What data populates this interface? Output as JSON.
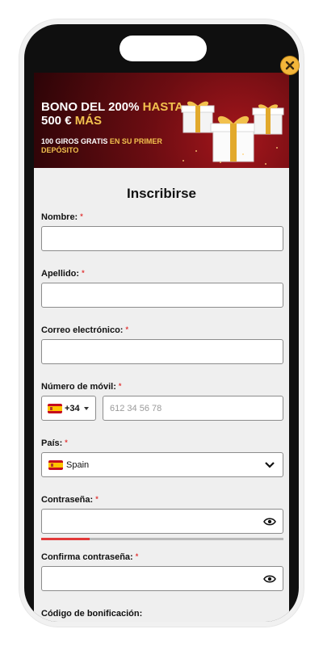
{
  "banner": {
    "title_white_1": "BONO DEL 200%",
    "title_gold_1": "HASTA",
    "title_white_2": "500 €",
    "title_gold_2": "MÁS",
    "sub_white": "100 GIROS GRATIS",
    "sub_gold": "EN SU PRIMER DEPÓSITO"
  },
  "form": {
    "title": "Inscribirse",
    "nombre_label": "Nombre:",
    "apellido_label": "Apellido:",
    "email_label": "Correo electrónico:",
    "movil_label": "Número de móvil:",
    "country_code": "+34",
    "phone_placeholder": "612 34 56 78",
    "pais_label": "País:",
    "pais_value": "Spain",
    "password_label": "Contraseña:",
    "confirm_label": "Confirma contraseña:",
    "bonus_label": "Código de bonificación:",
    "required_mark": "*"
  },
  "password_strength": 0.2,
  "colors": {
    "banner_red": "#7b0f14",
    "gold": "#f2c14e",
    "required": "#e23a3a",
    "close_button": "#f3b63b"
  },
  "icons": [
    "close-icon",
    "gift-icon",
    "spain-flag-icon",
    "chevron-down-icon",
    "eye-icon"
  ]
}
